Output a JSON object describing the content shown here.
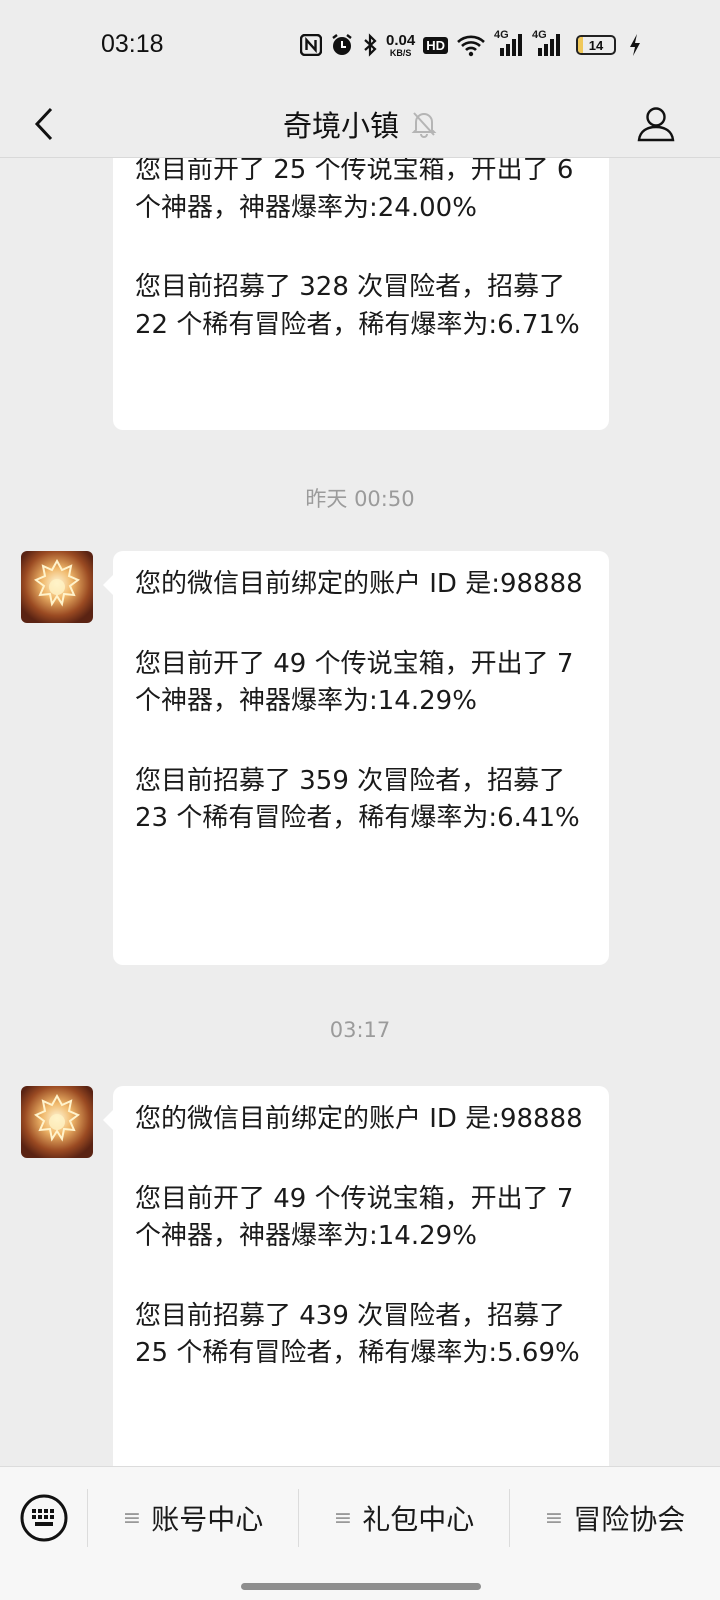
{
  "status_bar": {
    "time": "03:18",
    "net_speed_value": "0.04",
    "net_speed_unit": "KB/S",
    "hd_label": "HD",
    "signal_1_label": "4G",
    "signal_2_label": "4G",
    "battery_level": "14",
    "battery_fraction": 0.14,
    "battery_color": "#f0c85a",
    "icons": [
      "nfc-icon",
      "alarm-icon",
      "bluetooth-icon",
      "hd-voice-icon",
      "wifi-icon",
      "signal-icon",
      "signal-icon",
      "battery-icon",
      "charging-icon"
    ]
  },
  "header": {
    "title": "奇境小镇",
    "back_icon": "chevron-left-icon",
    "mute_icon": "bell-off-icon",
    "profile_icon": "person-icon"
  },
  "chat": {
    "messages": [
      {
        "paragraphs": [
          "您目前开了 25 个传说宝箱，开出了 6 个神器，神器爆率为:24.00%",
          "您目前招募了 328 次冒险者，招募了 22 个稀有冒险者，稀有爆率为:6.71%"
        ]
      },
      {
        "timestamp": "昨天 00:50",
        "paragraphs": [
          "您的微信目前绑定的账户 ID 是:98888",
          "您目前开了 49 个传说宝箱，开出了 7 个神器，神器爆率为:14.29%",
          "您目前招募了 359 次冒险者，招募了 23 个稀有冒险者，稀有爆率为:6.41%"
        ]
      },
      {
        "timestamp": "03:17",
        "paragraphs": [
          "您的微信目前绑定的账户 ID 是:98888",
          "您目前开了 49 个传说宝箱，开出了 7 个神器，神器爆率为:14.29%",
          "您目前招募了 439 次冒险者，招募了 25 个稀有冒险者，稀有爆率为:5.69%"
        ]
      }
    ]
  },
  "bottom_menu": {
    "keyboard_icon": "keyboard-icon",
    "menu_icon": "menu-lines-icon",
    "items": [
      {
        "label": "账号中心"
      },
      {
        "label": "礼包中心"
      },
      {
        "label": "冒险协会"
      }
    ]
  }
}
